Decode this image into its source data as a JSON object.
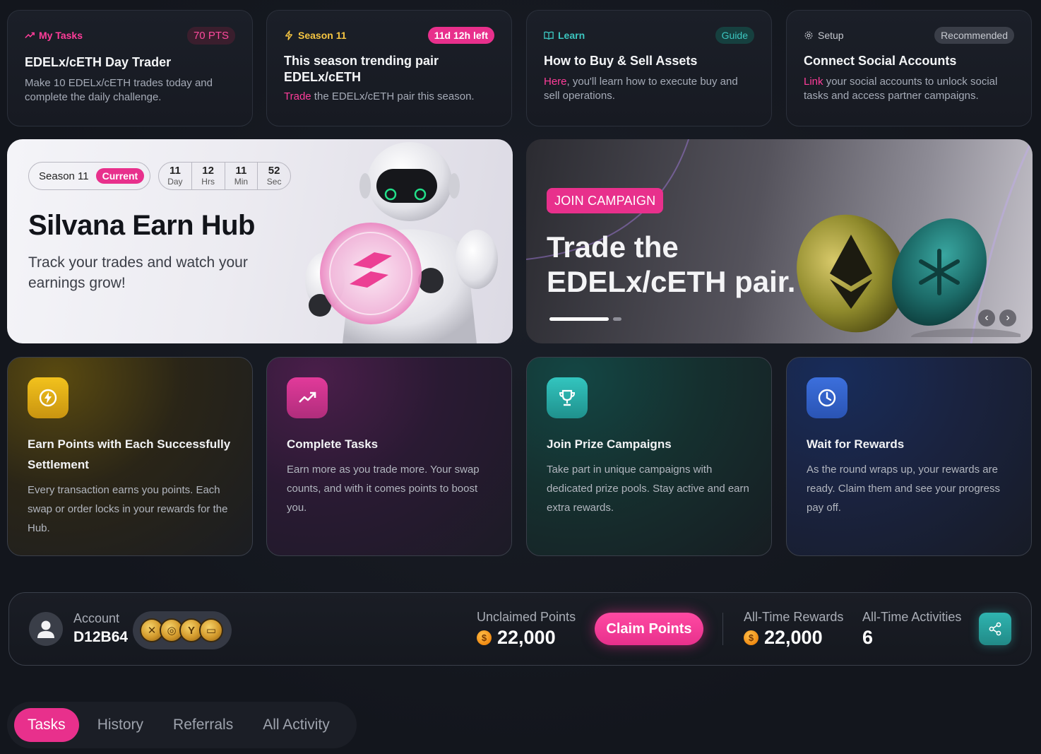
{
  "info_cards": [
    {
      "tag": "My Tasks",
      "tag_icon": "trending-icon",
      "tag_color": "#ff3d9a",
      "pill": "70 PTS",
      "title": "EDELx/cETH Day Trader",
      "desc_highlight": "",
      "desc": "Make 10 EDELx/cETH trades today and complete the daily challenge."
    },
    {
      "tag": "Season 11",
      "tag_icon": "lightning-icon",
      "tag_color": "#f5c542",
      "pill": "11d 12h left",
      "title": "This season trending pair EDELx/cETH",
      "desc_highlight": "Trade",
      "desc": " the EDELx/cETH pair this season."
    },
    {
      "tag": "Learn",
      "tag_icon": "book-icon",
      "tag_color": "#3cc6c0",
      "pill": "Guide",
      "title": "How to Buy & Sell Assets",
      "desc_highlight": "Here",
      "desc": ", you'll learn how to execute buy and sell operations."
    },
    {
      "tag": "Setup",
      "tag_icon": "gear-icon",
      "tag_color": "#c6c9d0",
      "pill": "Recommended",
      "title": "Connect Social Accounts",
      "desc_highlight": "Link",
      "desc": " your social accounts to unlock social tasks and access partner campaigns."
    }
  ],
  "hero": {
    "season_label": "Season 11",
    "current_label": "Current",
    "countdown": [
      {
        "num": "11",
        "unit": "Day"
      },
      {
        "num": "12",
        "unit": "Hrs"
      },
      {
        "num": "11",
        "unit": "Min"
      },
      {
        "num": "52",
        "unit": "Sec"
      }
    ],
    "title": "Silvana Earn Hub",
    "subtitle": "Track your trades and watch your earnings grow!"
  },
  "campaign": {
    "pill": "JOIN CAMPAIGN",
    "title": "Trade the EDELx/cETH pair.",
    "prev_label": "‹",
    "next_label": "›"
  },
  "features": [
    {
      "icon": "lightning-circle-icon",
      "title": "Earn Points with Each Successfully Settlement",
      "desc": "Every transaction earns you points. Each swap or order locks in your rewards for the Hub."
    },
    {
      "icon": "trending-up-icon",
      "title": "Complete Tasks",
      "desc": "Earn more as you trade more. Your swap counts, and with it comes points to boost you."
    },
    {
      "icon": "trophy-icon",
      "title": "Join Prize Campaigns",
      "desc": "Take part in unique campaigns with dedicated prize pools. Stay active and earn extra rewards."
    },
    {
      "icon": "clock-icon",
      "title": "Wait for Rewards",
      "desc": "As the round wraps up, your rewards are ready. Claim them and see your progress pay off."
    }
  ],
  "account": {
    "label": "Account",
    "id": "D12B64",
    "unclaimed_label": "Unclaimed Points",
    "unclaimed_value": "22,000",
    "claim_button": "Claim Points",
    "all_time_rewards_label": "All-Time Rewards",
    "all_time_rewards_value": "22,000",
    "all_time_activities_label": "All-Time Activities",
    "all_time_activities_value": "6"
  },
  "tabs": [
    "Tasks",
    "History",
    "Referrals",
    "All Activity"
  ],
  "colors": {
    "accent": "#e8308c",
    "teal": "#2fb4b0",
    "background": "#13161d"
  }
}
